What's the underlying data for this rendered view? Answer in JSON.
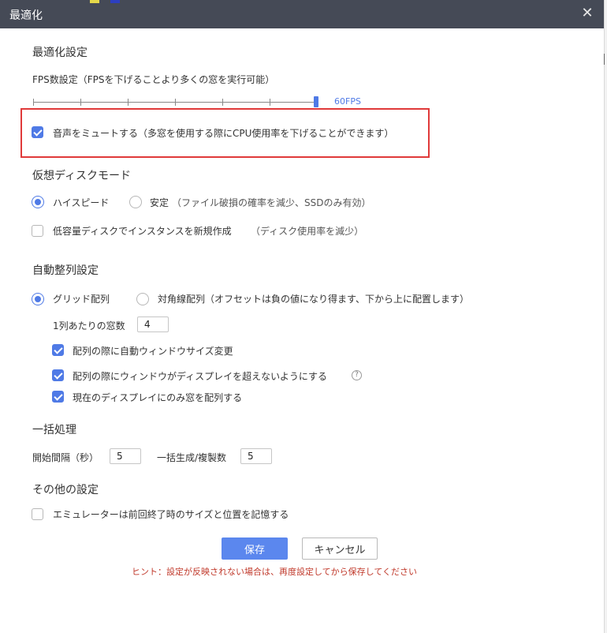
{
  "window": {
    "title": "最適化",
    "close_icon": "close-icon"
  },
  "optimization": {
    "heading": "最適化設定",
    "fps_label": "FPS数設定（FPSを下げることより多くの窓を実行可能）",
    "fps_value_label": "60FPS",
    "fps_level": 1.0,
    "mute_label": "音声をミュートする（多窓を使用する際にCPU使用率を下げることができます）",
    "mute_checked": true
  },
  "disk": {
    "heading": "仮想ディスクモード",
    "high_speed_label": "ハイスピード",
    "stable_label": "安定",
    "stable_note": "（ファイル破損の確率を減少、SSDのみ有効）",
    "selected": "high_speed",
    "low_capacity_label": "低容量ディスクでインスタンスを新規作成",
    "low_capacity_note": "（ディスク使用率を減少）",
    "low_capacity_checked": false
  },
  "arrange": {
    "heading": "自動整列設定",
    "grid_label": "グリッド配列",
    "diagonal_label": "対角線配列（オフセットは負の値になり得ます、下から上に配置します）",
    "selected": "grid",
    "per_column_label": "1列あたりの窓数",
    "per_column_value": "4",
    "auto_resize_label": "配列の際に自動ウィンドウサイズ変更",
    "auto_resize_checked": true,
    "no_overflow_label": "配列の際にウィンドウがディスプレイを超えないようにする",
    "no_overflow_checked": true,
    "help_icon": "help-icon",
    "help_glyph": "?",
    "current_display_label": "現在のディスプレイにのみ窓を配列する",
    "current_display_checked": true
  },
  "batch": {
    "heading": "一括処理",
    "interval_label": "開始間隔（秒）",
    "interval_value": "5",
    "clone_label": "一括生成/複製数",
    "clone_value": "5"
  },
  "other": {
    "heading": "その他の設定",
    "remember_label": "エミュレーターは前回終了時のサイズと位置を記憶する",
    "remember_checked": false
  },
  "footer": {
    "save_label": "保存",
    "cancel_label": "キャンセル",
    "hint": "ヒント：設定が反映されない場合は、再度設定してから保存してください"
  },
  "colors": {
    "accent": "#4f7ae6",
    "titlebar": "#454a56",
    "highlight_border": "#e03a3a",
    "hint": "#c0392b"
  }
}
